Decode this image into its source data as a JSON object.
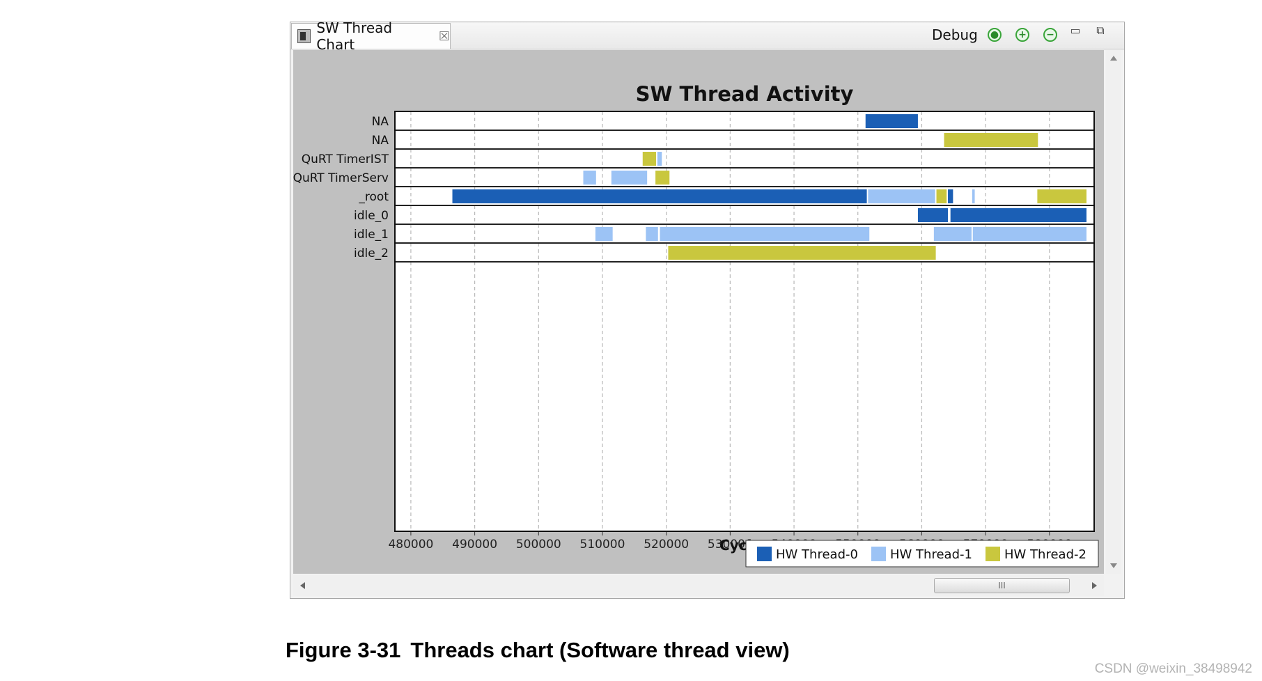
{
  "tab": {
    "title": "SW Thread Chart",
    "close_icon": "close-icon",
    "view_icon": "chart-view-icon"
  },
  "toolbar": {
    "debug_label": "Debug",
    "buttons": [
      {
        "icon": "reset-zoom-icon",
        "glyph": "●"
      },
      {
        "icon": "zoom-in-icon",
        "glyph": "+"
      },
      {
        "icon": "zoom-out-icon",
        "glyph": "−"
      }
    ],
    "minimize_glyph": "▭",
    "maximize_glyph": "⧉"
  },
  "scrollbar": {
    "thumb_grip": "III"
  },
  "chart_data": {
    "type": "gantt",
    "title": "SW Thread Activity",
    "xlabel": "Cycles",
    "ylabel": "",
    "xlim": [
      477500,
      587000
    ],
    "xticks": [
      480000,
      490000,
      500000,
      510000,
      520000,
      530000,
      540000,
      550000,
      560000,
      570000,
      580000
    ],
    "grid": "vertical dashed",
    "legend_position": "bottom-right",
    "legend": [
      {
        "name": "HW Thread-0",
        "color": "#1b5fb5"
      },
      {
        "name": "HW Thread-1",
        "color": "#9cc3f5"
      },
      {
        "name": "HW Thread-2",
        "color": "#c9c73e"
      }
    ],
    "rows": [
      {
        "label": "NA",
        "segments": [
          {
            "start": 551200,
            "end": 559400,
            "hw": 0
          }
        ]
      },
      {
        "label": "NA",
        "segments": [
          {
            "start": 563500,
            "end": 578200,
            "hw": 2
          }
        ]
      },
      {
        "label": "QuRT TimerIST",
        "segments": [
          {
            "start": 516300,
            "end": 518400,
            "hw": 2
          },
          {
            "start": 518600,
            "end": 519300,
            "hw": 1
          }
        ]
      },
      {
        "label": "QuRT TimerServ",
        "segments": [
          {
            "start": 507000,
            "end": 509000,
            "hw": 1
          },
          {
            "start": 511400,
            "end": 517000,
            "hw": 1
          },
          {
            "start": 518300,
            "end": 520500,
            "hw": 2
          }
        ]
      },
      {
        "label": "_root",
        "segments": [
          {
            "start": 486500,
            "end": 551400,
            "hw": 0
          },
          {
            "start": 551600,
            "end": 562100,
            "hw": 1
          },
          {
            "start": 562300,
            "end": 563900,
            "hw": 2
          },
          {
            "start": 564100,
            "end": 564900,
            "hw": 0
          },
          {
            "start": 567900,
            "end": 568300,
            "hw": 1
          },
          {
            "start": 578100,
            "end": 585800,
            "hw": 2
          }
        ]
      },
      {
        "label": "idle_0",
        "segments": [
          {
            "start": 559400,
            "end": 564100,
            "hw": 0
          },
          {
            "start": 564500,
            "end": 585800,
            "hw": 0
          }
        ]
      },
      {
        "label": "idle_1",
        "segments": [
          {
            "start": 508900,
            "end": 511600,
            "hw": 1
          },
          {
            "start": 516800,
            "end": 518700,
            "hw": 1
          },
          {
            "start": 519000,
            "end": 551800,
            "hw": 1
          },
          {
            "start": 561900,
            "end": 567800,
            "hw": 1
          },
          {
            "start": 568000,
            "end": 585800,
            "hw": 1
          }
        ]
      },
      {
        "label": "idle_2",
        "segments": [
          {
            "start": 520300,
            "end": 562200,
            "hw": 2
          }
        ]
      }
    ]
  },
  "caption": {
    "number": "Figure 3-31",
    "text": "Threads chart (Software thread view)"
  },
  "watermark": "CSDN @weixin_38498942"
}
